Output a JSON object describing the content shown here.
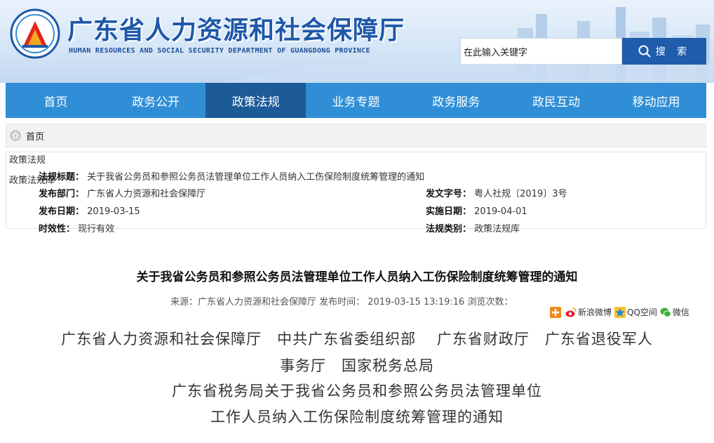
{
  "header": {
    "title": "广东省人力资源和社会保障厅",
    "subtitle": "HUMAN RESOURCES AND SOCIAL SECURITY DEPARTMENT OF GUANGDONG PROVINCE"
  },
  "search": {
    "value": "在此输入关键字",
    "button_label": "搜 索"
  },
  "nav": {
    "items": [
      {
        "label": "首页"
      },
      {
        "label": "政务公开"
      },
      {
        "label": "政策法规"
      },
      {
        "label": "业务专题"
      },
      {
        "label": "政务服务"
      },
      {
        "label": "政民互动"
      },
      {
        "label": "移动应用"
      }
    ],
    "active_index": 2
  },
  "breadcrumb": {
    "home": "首页"
  },
  "info": {
    "side_label_1": "政策法规",
    "side_label_2": "政策法规库",
    "title_key": "法规标题：",
    "title_val": "关于我省公务员和参照公务员法管理单位工作人员纳入工伤保险制度统筹管理的通知",
    "dept_key": "发布部门：",
    "dept_val": "广东省人力资源和社会保障厅",
    "doc_key": "发文字号：",
    "doc_val": "粤人社规〔2019〕3号",
    "pub_key": "发布日期：",
    "pub_val": "2019-03-15",
    "impl_key": "实施日期：",
    "impl_val": "2019-04-01",
    "valid_key": "时效性：",
    "valid_val": "现行有效",
    "cat_key": "法规类别：",
    "cat_val": "政策法规库"
  },
  "article": {
    "title": "关于我省公务员和参照公务员法管理单位工作人员纳入工伤保险制度统筹管理的通知",
    "meta": "来源：广东省人力资源和社会保障厅   发布时间： 2019-03-15 13:19:16   浏览次数：",
    "share": {
      "weibo": "新浪微博",
      "qzone": "QQ空间",
      "wechat": "微信"
    },
    "lines": [
      "广东省人力资源和社会保障厅　中共广东省委组织部　 广东省财政厅　广东省退役军人",
      "事务厅　国家税务总局",
      "广东省税务局关于我省公务员和参照公务员法管理单位",
      "工作人员纳入工伤保险制度统筹管理的通知"
    ]
  },
  "colors": {
    "nav_bg": "#2f8ed6",
    "nav_active": "#1d5b98",
    "brand_blue": "#1e57a8"
  }
}
